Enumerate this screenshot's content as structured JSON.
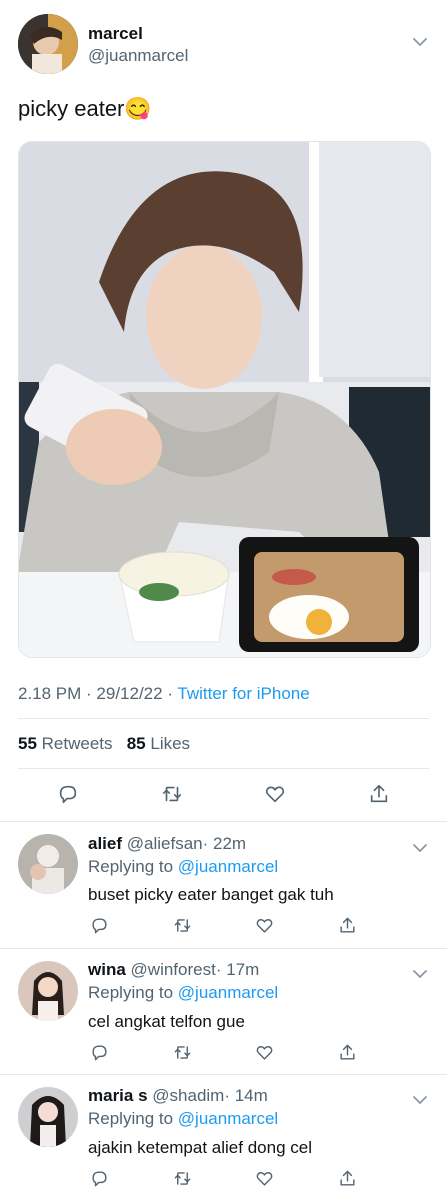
{
  "tweet": {
    "display_name": "marcel",
    "handle": "@juanmarcel",
    "text": "picky eater",
    "emoji": "😋",
    "time": "2.18 PM · 29/12/22 · ",
    "source": "Twitter for iPhone",
    "retweets_count": "55",
    "retweets_label": "Retweets",
    "likes_count": "85",
    "likes_label": "Likes"
  },
  "replies": [
    {
      "name": "alief",
      "handle": "@aliefsan",
      "time": "· 22m",
      "replying_label": "Replying to",
      "replying_to": "@juanmarcel",
      "text": "buset picky eater banget gak tuh",
      "avatar_color": "#b9b3ad"
    },
    {
      "name": "wina",
      "handle": "@winforest",
      "time": "· 17m",
      "replying_label": "Replying to",
      "replying_to": "@juanmarcel",
      "text": "cel angkat telfon gue",
      "avatar_color": "#d9c7bd"
    },
    {
      "name": "maria s",
      "handle": "@shadim",
      "time": "· 14m",
      "replying_label": "Replying to",
      "replying_to": "@juanmarcel",
      "text": "ajakin ketempat alief dong cel",
      "avatar_color": "#cfcfd2"
    }
  ],
  "colors": {
    "accent": "#1d9bf0",
    "muted": "#536471"
  }
}
